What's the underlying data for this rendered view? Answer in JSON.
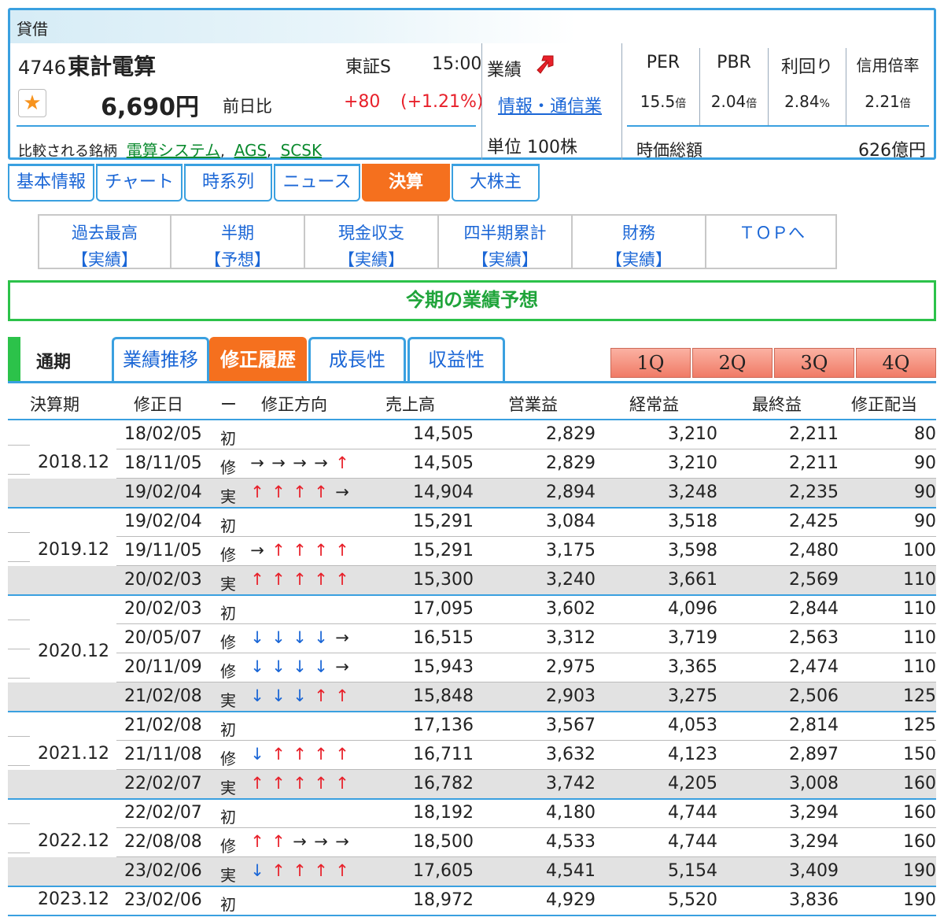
{
  "header": {
    "taishaku": "貸借",
    "code": "4746",
    "name": "東計電算",
    "market": "東証S",
    "time": "15:00",
    "price": "6,690円",
    "prev_label": "前日比",
    "change": "+80",
    "change_pct": "(+1.21%)",
    "compare_label": "比較される銘柄",
    "compare": [
      "電算システム",
      "AGS",
      "SCSK"
    ],
    "gyoseki_label": "業績",
    "sector": "情報・通信業",
    "unit": "単位 100株",
    "metrics": [
      {
        "label": "PER",
        "value": "15.5",
        "unit": "倍"
      },
      {
        "label": "PBR",
        "value": "2.04",
        "unit": "倍"
      },
      {
        "label": "利回り",
        "value": "2.84",
        "unit": "%"
      },
      {
        "label": "信用倍率",
        "value": "2.21",
        "unit": "倍"
      }
    ],
    "mcap_label": "時価総額",
    "mcap_value": "626億円"
  },
  "main_tabs": [
    "基本情報",
    "チャート",
    "時系列",
    "ニュース",
    "決算",
    "大株主"
  ],
  "sub_tabs": [
    {
      "l1": "過去最高",
      "l2": "【実績】"
    },
    {
      "l1": "半期",
      "l2": "【予想】"
    },
    {
      "l1": "現金収支",
      "l2": "【実績】"
    },
    {
      "l1": "四半期累計",
      "l2": "【実績】"
    },
    {
      "l1": "財務",
      "l2": "【実績】"
    },
    {
      "l1": "ＴＯＰへ",
      "l2": ""
    }
  ],
  "section_title": "今期の業績予想",
  "period_label": "通期",
  "lower_tabs": [
    "業績推移",
    "修正履歴",
    "成長性",
    "収益性"
  ],
  "quarter_tabs": [
    "1Q",
    "2Q",
    "3Q",
    "4Q"
  ],
  "table": {
    "headers": [
      "決算期",
      "修正日",
      "ー",
      "修正方向",
      "売上高",
      "営業益",
      "経常益",
      "最終益",
      "修正配当"
    ],
    "groups": [
      {
        "year": "2018.12",
        "rows": [
          {
            "date": "18/02/05",
            "type": "初",
            "dir": "",
            "sales": "14,505",
            "op": "2,829",
            "ord": "3,210",
            "net": "2,211",
            "div": "80"
          },
          {
            "date": "18/11/05",
            "type": "修",
            "dir": "→→→→↑",
            "sales": "14,505",
            "op": "2,829",
            "ord": "3,210",
            "net": "2,211",
            "div": "90"
          },
          {
            "date": "19/02/04",
            "type": "実",
            "dir": "↑↑↑↑→",
            "sales": "14,904",
            "op": "2,894",
            "ord": "3,248",
            "net": "2,235",
            "div": "90"
          }
        ]
      },
      {
        "year": "2019.12",
        "rows": [
          {
            "date": "19/02/04",
            "type": "初",
            "dir": "",
            "sales": "15,291",
            "op": "3,084",
            "ord": "3,518",
            "net": "2,425",
            "div": "90"
          },
          {
            "date": "19/11/05",
            "type": "修",
            "dir": "→↑↑↑↑",
            "sales": "15,291",
            "op": "3,175",
            "ord": "3,598",
            "net": "2,480",
            "div": "100"
          },
          {
            "date": "20/02/03",
            "type": "実",
            "dir": "↑↑↑↑↑",
            "sales": "15,300",
            "op": "3,240",
            "ord": "3,661",
            "net": "2,569",
            "div": "110"
          }
        ]
      },
      {
        "year": "2020.12",
        "rows": [
          {
            "date": "20/02/03",
            "type": "初",
            "dir": "",
            "sales": "17,095",
            "op": "3,602",
            "ord": "4,096",
            "net": "2,844",
            "div": "110"
          },
          {
            "date": "20/05/07",
            "type": "修",
            "dir": "↓↓↓↓→",
            "sales": "16,515",
            "op": "3,312",
            "ord": "3,719",
            "net": "2,563",
            "div": "110"
          },
          {
            "date": "20/11/09",
            "type": "修",
            "dir": "↓↓↓↓→",
            "sales": "15,943",
            "op": "2,975",
            "ord": "3,365",
            "net": "2,474",
            "div": "110"
          },
          {
            "date": "21/02/08",
            "type": "実",
            "dir": "↓↓↓↑↑",
            "sales": "15,848",
            "op": "2,903",
            "ord": "3,275",
            "net": "2,506",
            "div": "125"
          }
        ]
      },
      {
        "year": "2021.12",
        "rows": [
          {
            "date": "21/02/08",
            "type": "初",
            "dir": "",
            "sales": "17,136",
            "op": "3,567",
            "ord": "4,053",
            "net": "2,814",
            "div": "125"
          },
          {
            "date": "21/11/08",
            "type": "修",
            "dir": "↓↑↑↑↑",
            "sales": "16,711",
            "op": "3,632",
            "ord": "4,123",
            "net": "2,897",
            "div": "150"
          },
          {
            "date": "22/02/07",
            "type": "実",
            "dir": "↑↑↑↑↑",
            "sales": "16,782",
            "op": "3,742",
            "ord": "4,205",
            "net": "3,008",
            "div": "160"
          }
        ]
      },
      {
        "year": "2022.12",
        "rows": [
          {
            "date": "22/02/07",
            "type": "初",
            "dir": "",
            "sales": "18,192",
            "op": "4,180",
            "ord": "4,744",
            "net": "3,294",
            "div": "160"
          },
          {
            "date": "22/08/08",
            "type": "修",
            "dir": "↑↑→→→",
            "sales": "18,500",
            "op": "4,533",
            "ord": "4,744",
            "net": "3,294",
            "div": "160"
          },
          {
            "date": "23/02/06",
            "type": "実",
            "dir": "↓↑↑↑↑",
            "sales": "17,605",
            "op": "4,541",
            "ord": "5,154",
            "net": "3,409",
            "div": "190"
          }
        ]
      },
      {
        "year": "2023.12",
        "rows": [
          {
            "date": "23/02/06",
            "type": "初",
            "dir": "",
            "sales": "18,972",
            "op": "4,929",
            "ord": "5,520",
            "net": "3,836",
            "div": "190"
          }
        ]
      }
    ]
  },
  "colors": {
    "accent_blue": "#3aa0e0",
    "active_orange": "#f5701e",
    "up_red": "#e8202a",
    "down_blue": "#1a66d6",
    "green": "#2cc24a"
  }
}
